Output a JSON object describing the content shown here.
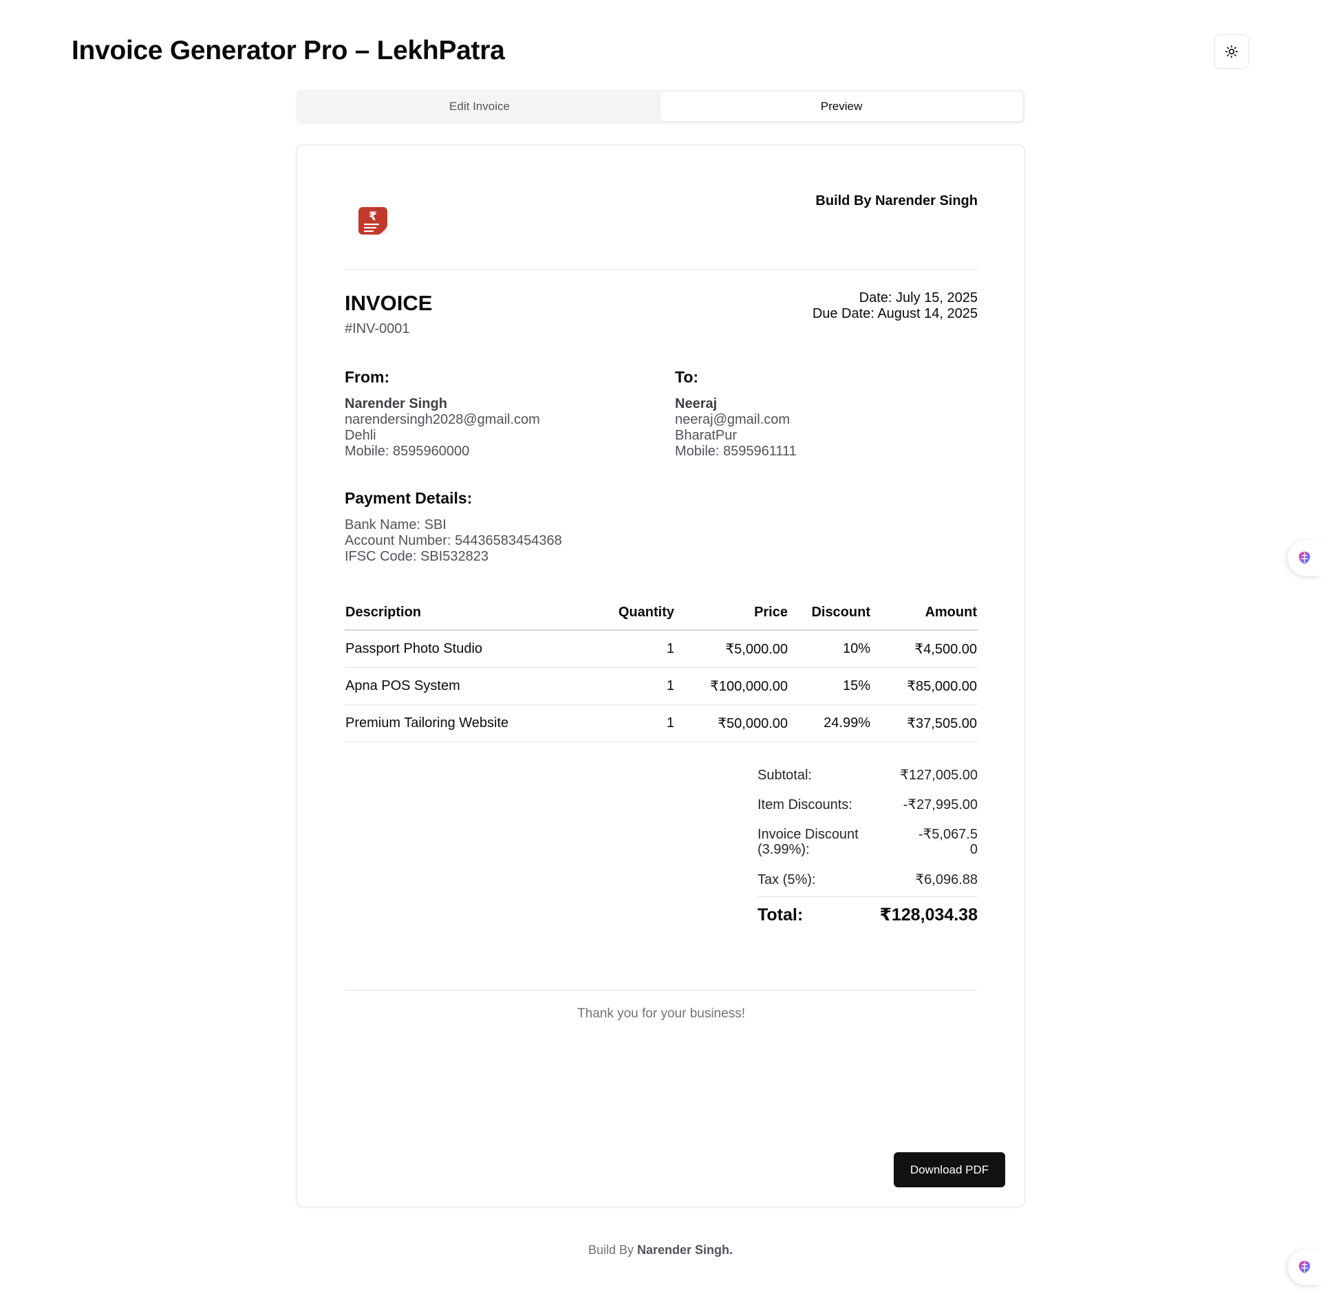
{
  "app": {
    "title": "Invoice Generator Pro – LekhPatra"
  },
  "tabs": [
    {
      "label": "Edit Invoice",
      "active": false
    },
    {
      "label": "Preview",
      "active": true
    }
  ],
  "invoice": {
    "build_by": "Build By Narender Singh",
    "title": "INVOICE",
    "number": "#INV-0001",
    "date": "Date: July 15, 2025",
    "due_date": "Due Date: August 14, 2025",
    "from": {
      "heading": "From:",
      "name": "Narender Singh",
      "email": "narendersingh2028@gmail.com",
      "city": "Dehli",
      "mobile": "Mobile: 8595960000"
    },
    "to": {
      "heading": "To:",
      "name": "Neeraj",
      "email": "neeraj@gmail.com",
      "city": "BharatPur",
      "mobile": "Mobile: 8595961111"
    },
    "payment": {
      "heading": "Payment Details:",
      "bank": "Bank Name: SBI",
      "account": "Account Number: 54436583454368",
      "ifsc": "IFSC Code: SBI532823"
    },
    "table": {
      "headers": [
        "Description",
        "Quantity",
        "Price",
        "Discount",
        "Amount"
      ],
      "rows": [
        [
          "Passport Photo Studio",
          "1",
          "₹5,000.00",
          "10%",
          "₹4,500.00"
        ],
        [
          "Apna POS System",
          "1",
          "₹100,000.00",
          "15%",
          "₹85,000.00"
        ],
        [
          "Premium Tailoring Website",
          "1",
          "₹50,000.00",
          "24.99%",
          "₹37,505.00"
        ]
      ]
    },
    "totals": {
      "subtotal_label": "Subtotal:",
      "subtotal": "₹127,005.00",
      "item_discounts_label": "Item Discounts:",
      "item_discounts": "-₹27,995.00",
      "invoice_discount_label": "Invoice Discount (3.99%):",
      "invoice_discount": "-₹5,067.50",
      "tax_label": "Tax (5%):",
      "tax": "₹6,096.88",
      "total_label": "Total:",
      "total": "₹128,034.38"
    },
    "thanks": "Thank you for your business!",
    "download_label": "Download PDF"
  },
  "footer": {
    "prefix": "Build By ",
    "name": "Narender Singh."
  },
  "icons": {
    "theme_toggle": "sun-icon",
    "logo": "rupee-invoice-logo",
    "side_widget": "brain-icon"
  },
  "colors": {
    "logo_red": "#c0392b",
    "button_bg": "#111111",
    "widget_gradient": [
      "#f43f5e",
      "#8b5cf6",
      "#3b82f6"
    ]
  }
}
